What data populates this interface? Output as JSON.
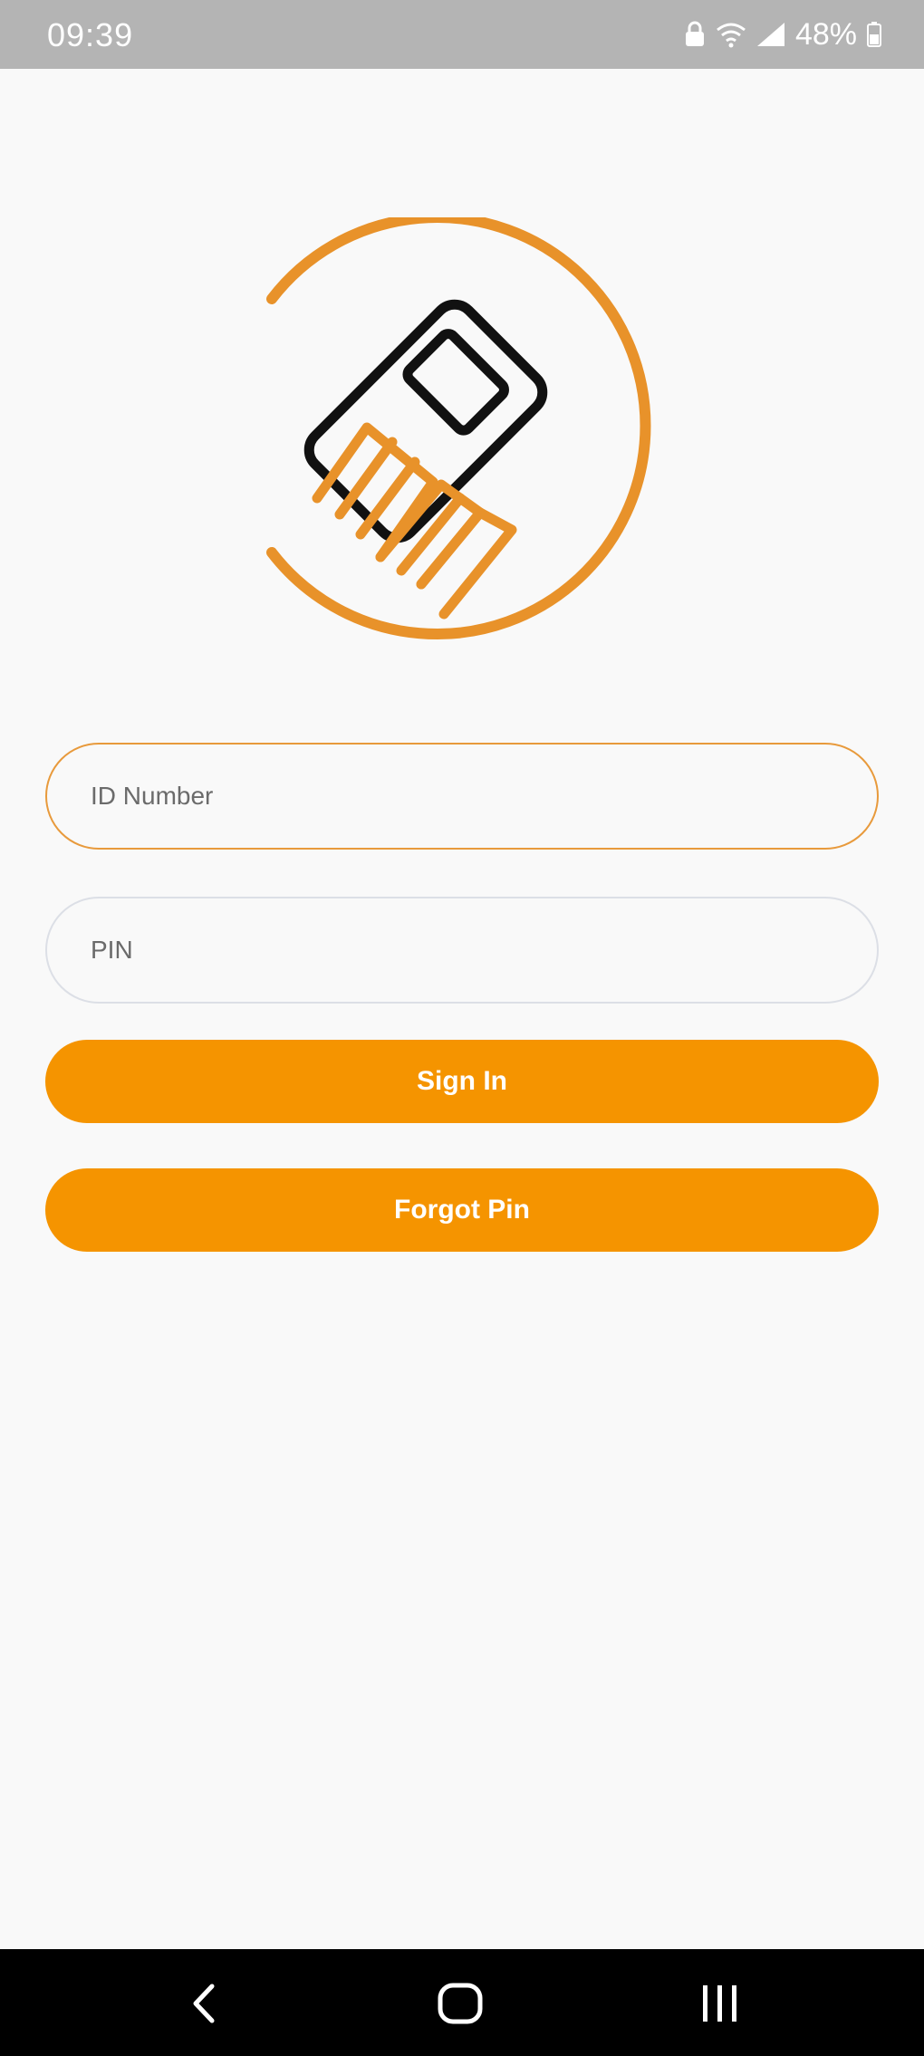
{
  "status_bar": {
    "time": "09:39",
    "battery": "48%",
    "icons": [
      "lock-icon",
      "wifi-icon",
      "signal-icon",
      "battery-icon"
    ]
  },
  "logo": {
    "name": "card-hand-logo",
    "colors": {
      "ring": "#e8922a",
      "card": "#111111",
      "hand": "#e8922a"
    }
  },
  "form": {
    "id_number": {
      "placeholder": "ID Number",
      "value": ""
    },
    "pin": {
      "placeholder": "PIN",
      "value": ""
    },
    "sign_in_label": "Sign In",
    "forgot_pin_label": "Forgot Pin"
  },
  "nav_bar": {
    "buttons": [
      "back-icon",
      "home-icon",
      "recents-icon"
    ]
  },
  "colors": {
    "accent": "#f59400",
    "active_field_border": "#e89a3c",
    "inactive_field_border": "#dcdfe6",
    "background": "#f9f9f9",
    "status_bar": "#b4b4b4",
    "nav_bar": "#000000"
  }
}
